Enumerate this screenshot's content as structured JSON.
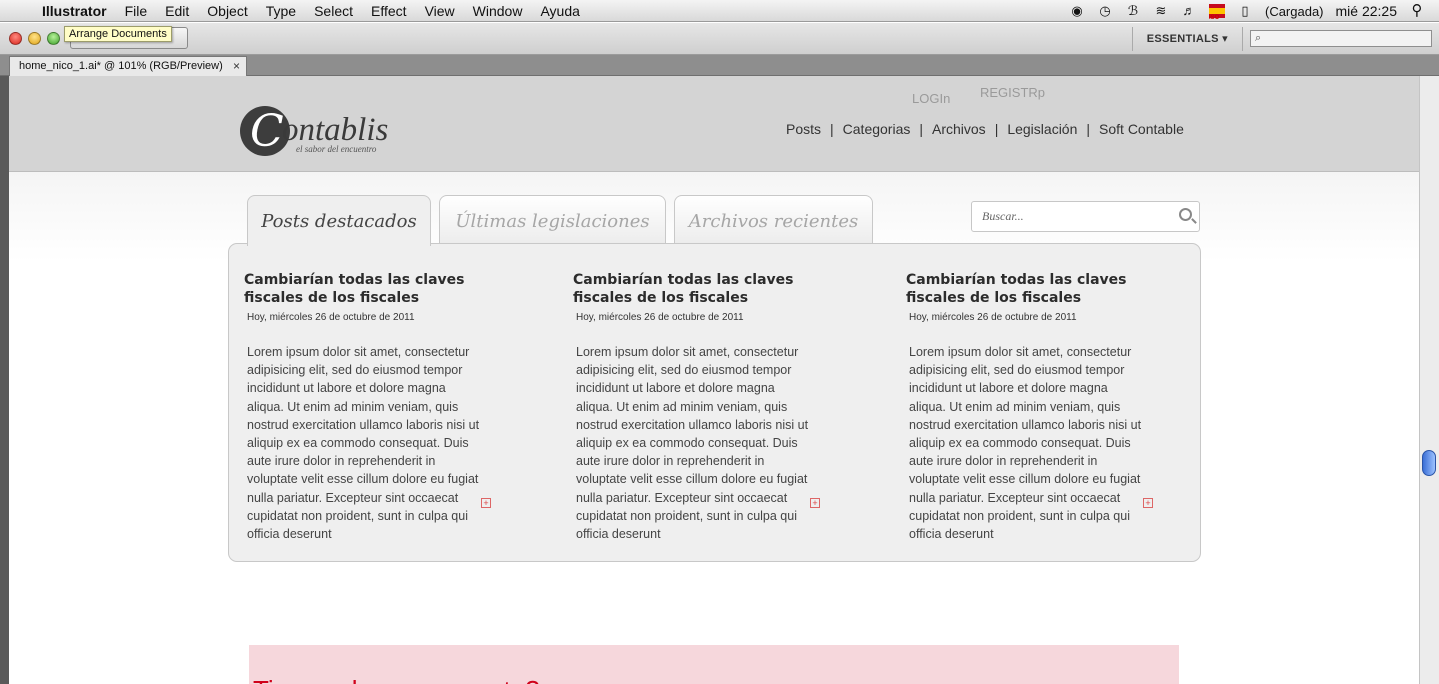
{
  "menubar": {
    "apple": "",
    "app_name": "Illustrator",
    "items": [
      "File",
      "Edit",
      "Object",
      "Type",
      "Select",
      "Effect",
      "View",
      "Window",
      "Ayuda"
    ],
    "battery_text": "(Cargada)",
    "clock": "mié 22:25"
  },
  "controlbar": {
    "tooltip": "Arrange Documents",
    "workspace": "ESSENTIALS ▾",
    "search_placeholder": "⌕"
  },
  "document_tab": {
    "title": "home_nico_1.ai* @ 101% (RGB/Preview)",
    "close": "×"
  },
  "site": {
    "logo": {
      "initial": "C",
      "rest": "ontablis",
      "tagline": "el sabor del encuentro"
    },
    "auth": {
      "login": "LOGIn",
      "register": "REGISTRp"
    },
    "nav": [
      "Posts",
      "Categorias",
      "Archivos",
      "Legislación",
      "Soft Contable"
    ],
    "nav_separator": "|",
    "tabs": [
      "Posts destacados",
      "Últimas legislaciones",
      "Archivos recientes"
    ],
    "search_placeholder": "Buscar...",
    "posts": [
      {
        "title": "Cambiarían todas las claves fiscales de los fiscales",
        "date": "Hoy, miércoles 26 de octubre de 2011",
        "body": "Lorem ipsum dolor sit amet, consectetur adipisicing elit, sed do eiusmod tempor incididunt ut labore et dolore magna aliqua. Ut enim ad minim veniam, quis nostrud exercitation ullamco laboris nisi ut aliquip ex ea commodo consequat. Duis aute irure dolor in reprehenderit in voluptate velit esse cillum dolore eu fugiat nulla pariatur. Excepteur sint occaecat cupidatat non proident, sunt in culpa qui officia deserunt",
        "more": "+"
      },
      {
        "title": "Cambiarían todas las claves fiscales de los fiscales",
        "date": "Hoy, miércoles 26 de octubre de 2011",
        "body": "Lorem ipsum dolor sit amet, consectetur adipisicing elit, sed do eiusmod tempor incididunt ut labore et dolore magna aliqua. Ut enim ad minim veniam, quis nostrud exercitation ullamco laboris nisi ut aliquip ex ea commodo consequat. Duis aute irure dolor in reprehenderit in voluptate velit esse cillum dolore eu fugiat nulla pariatur. Excepteur sint occaecat cupidatat non proident, sunt in culpa qui officia deserunt",
        "more": "+"
      },
      {
        "title": "Cambiarían todas las claves fiscales de los fiscales",
        "date": "Hoy, miércoles 26 de octubre de 2011",
        "body": "Lorem ipsum dolor sit amet, consectetur adipisicing elit, sed do eiusmod tempor incididunt ut labore et dolore magna aliqua. Ut enim ad minim veniam, quis nostrud exercitation ullamco laboris nisi ut aliquip ex ea commodo consequat. Duis aute irure dolor in reprehenderit in voluptate velit esse cillum dolore eu fugiat nulla pariatur. Excepteur sint occaecat cupidatat non proident, sunt in culpa qui officia deserunt",
        "more": "+"
      }
    ],
    "pink_heading": "Tienes alguna pregunta?"
  },
  "colors": {
    "header_bg": "#d4d4d4",
    "panel_bg": "#efefef",
    "pink_box": "#f6d7dc",
    "pink_text": "#d0021b"
  }
}
